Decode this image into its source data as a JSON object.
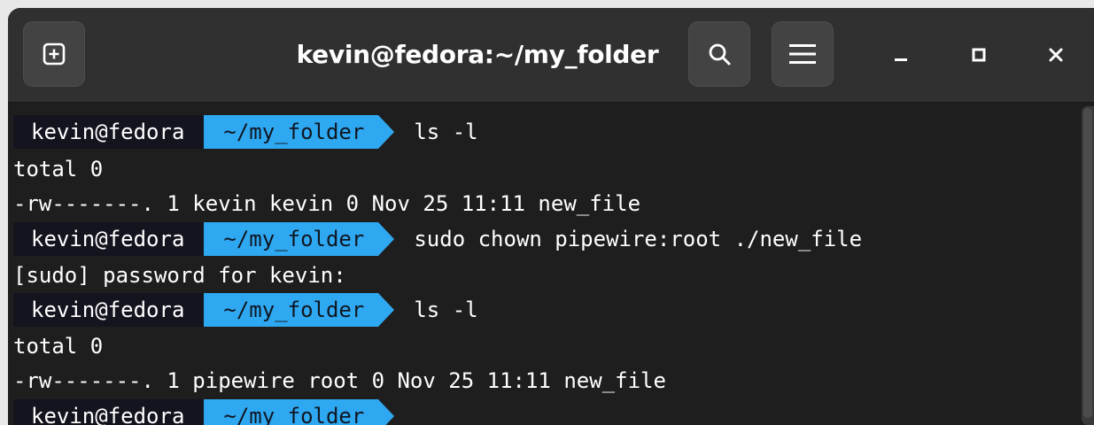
{
  "window": {
    "title": "kevin@fedora:~/my_folder"
  },
  "headerbar": {
    "new_tab_icon": "tab-new-icon",
    "search_icon": "search-icon",
    "menu_icon": "hamburger-menu-icon",
    "minimize_icon": "minimize-icon",
    "maximize_icon": "maximize-icon",
    "close_icon": "close-icon"
  },
  "theme": {
    "prompt_user_bg": "#14141f",
    "prompt_path_bg": "#2fa8f2",
    "terminal_bg": "#1e1e1e",
    "headerbar_bg": "#303030"
  },
  "terminal": {
    "lines": [
      {
        "type": "prompt",
        "user": "kevin@fedora",
        "path": "~/my_folder",
        "command": "ls -l"
      },
      {
        "type": "output",
        "text": "total 0"
      },
      {
        "type": "output",
        "text": "-rw-------. 1 kevin kevin 0 Nov 25 11:11 new_file"
      },
      {
        "type": "prompt",
        "user": "kevin@fedora",
        "path": "~/my_folder",
        "command": "sudo chown pipewire:root ./new_file"
      },
      {
        "type": "output",
        "text": "[sudo] password for kevin:"
      },
      {
        "type": "prompt",
        "user": "kevin@fedora",
        "path": "~/my_folder",
        "command": "ls -l"
      },
      {
        "type": "output",
        "text": "total 0"
      },
      {
        "type": "output",
        "text": "-rw-------. 1 pipewire root 0 Nov 25 11:11 new_file"
      },
      {
        "type": "prompt",
        "user": "kevin@fedora",
        "path": "~/my_folder",
        "command": ""
      }
    ]
  }
}
